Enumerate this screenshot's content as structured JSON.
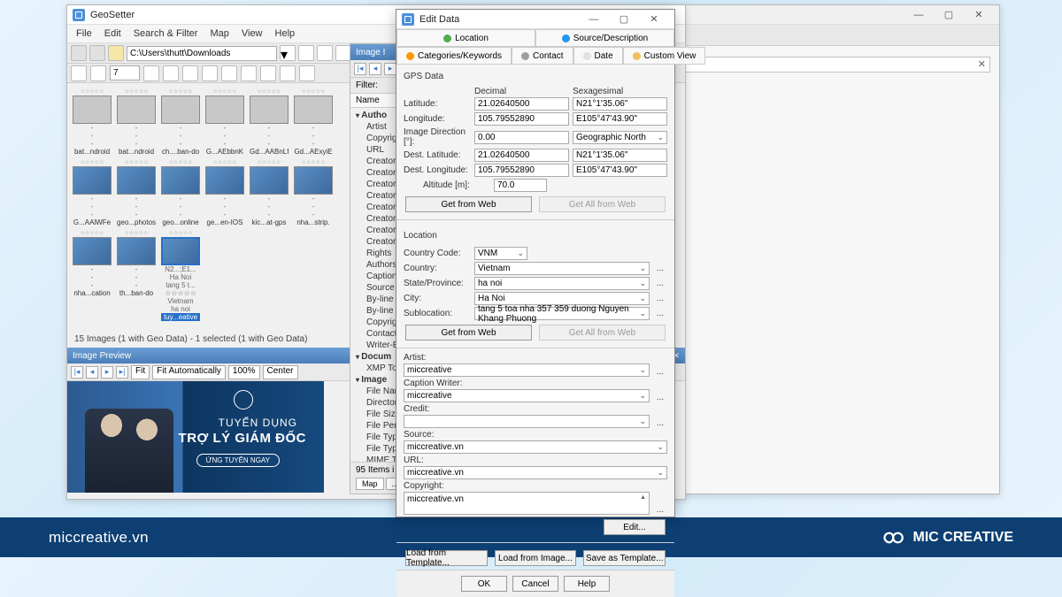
{
  "footer": {
    "site": "miccreative.vn",
    "brand": "MIC CREATIVE"
  },
  "gs": {
    "title": "GeoSetter",
    "menu": [
      "File",
      "Edit",
      "Search & Filter",
      "Map",
      "View",
      "Help"
    ],
    "path": "C:\\Users\\thutt\\Downloads",
    "spin": "7",
    "status": "15 Images (1 with Geo Data) - 1 selected (1 with Geo Data)",
    "preview_hdr": "Image Preview",
    "fit": "Fit",
    "fit_auto": "Fit Automatically",
    "zoom": "100%",
    "center": "Center",
    "ad": {
      "line1": "TUYỂN DỤNG",
      "line2": "TRỢ LÝ GIÁM ĐỐC",
      "cta": "ỨNG TUYỂN NGAY"
    },
    "thumbs_r1": [
      "bat...ndroid",
      "bat...ndroid",
      "ch....ban-do",
      "G...AEbbnK",
      "Gd...AABnLf",
      "Gd...AExyiE"
    ],
    "thumbs_r2": [
      "G...AAlWFe",
      "geo...photos",
      "geo...online",
      "ge...en-IOS",
      "kic...at-gps",
      "nha...strip."
    ],
    "thumbs_r3": [
      "nha...cation",
      "th...ban-do",
      "tuy...eative"
    ],
    "thumb_sel_lines": [
      "N2...;E1...",
      "Ha Noi",
      "tang 5 t...",
      "☆☆☆☆☆",
      "Vietnam",
      "ha noi"
    ]
  },
  "mid": {
    "hdr": "Image I",
    "filter": "Filter:",
    "name": "Name",
    "groups": [
      {
        "g": "Autho",
        "items": [
          "Artist",
          "Copyright",
          "URL",
          "Creator I",
          "Creator I",
          "Creator I",
          "Creator I",
          "Creator I",
          "Creator I",
          "Creator I",
          "Creator I",
          "Rights",
          "Authors",
          "Caption I",
          "Source",
          "By-line",
          "By-line T",
          "Copyright",
          "Contact:",
          "Writer-E"
        ]
      },
      {
        "g": "Docum",
        "items": [
          "XMP Too"
        ]
      },
      {
        "g": "Image",
        "items": [
          "File Nam",
          "Directory",
          "File Size",
          "File Perm",
          "File Type",
          "File Type",
          "MIME Ty"
        ]
      }
    ],
    "btm": "95 Items i",
    "tabs": [
      "Map",
      "..."
    ]
  },
  "ed": {
    "title": "Edit Data",
    "tabs_top": [
      "Location",
      "Source/Description"
    ],
    "tabs2": [
      "Categories/Keywords",
      "Contact",
      "Date",
      "Custom View"
    ],
    "gps_sec": "GPS Data",
    "col_dec": "Decimal",
    "col_sex": "Sexagesimal",
    "lat_l": "Latitude:",
    "lat_d": "21.02640500",
    "lat_s": "N21°1'35.06\"",
    "lon_l": "Longitude:",
    "lon_d": "105.79552890",
    "lon_s": "E105°47'43.90\"",
    "dir_l": "Image Direction [°]:",
    "dir_v": "0.00",
    "dir_ref": "Geographic North",
    "dlat_l": "Dest. Latitude:",
    "dlat_d": "21.02640500",
    "dlat_s": "N21°1'35.06\"",
    "dlon_l": "Dest. Longitude:",
    "dlon_d": "105.79552890",
    "dlon_s": "E105°47'43.90\"",
    "alt_l": "Altitude [m]:",
    "alt_v": "70.0",
    "get_web": "Get from Web",
    "get_all": "Get All from Web",
    "loc_sec": "Location",
    "cc_l": "Country Code:",
    "cc_v": "VNM",
    "cn_l": "Country:",
    "cn_v": "Vietnam",
    "sp_l": "State/Province:",
    "sp_v": "ha noi",
    "ci_l": "City:",
    "ci_v": "Ha Noi",
    "sl_l": "Sublocation:",
    "sl_v": "tang 5 toa nha 357 359 duong Nguyen Khang Phuong",
    "ar_l": "Artist:",
    "ar_v": "miccreative",
    "cw_l": "Caption Writer:",
    "cw_v": "miccreative",
    "cr_l": "Credit:",
    "cr_v": "",
    "so_l": "Source:",
    "so_v": "miccreative.vn",
    "ur_l": "URL:",
    "ur_v": "miccreative.vn",
    "cp_l": "Copyright:",
    "cp_v": "miccreative.vn",
    "edit_btn": "Edit...",
    "load_tpl": "Load from Template...",
    "load_img": "Load from Image...",
    "save_tpl": "Save as Template...",
    "ok": "OK",
    "cancel": "Cancel",
    "help": "Help"
  }
}
